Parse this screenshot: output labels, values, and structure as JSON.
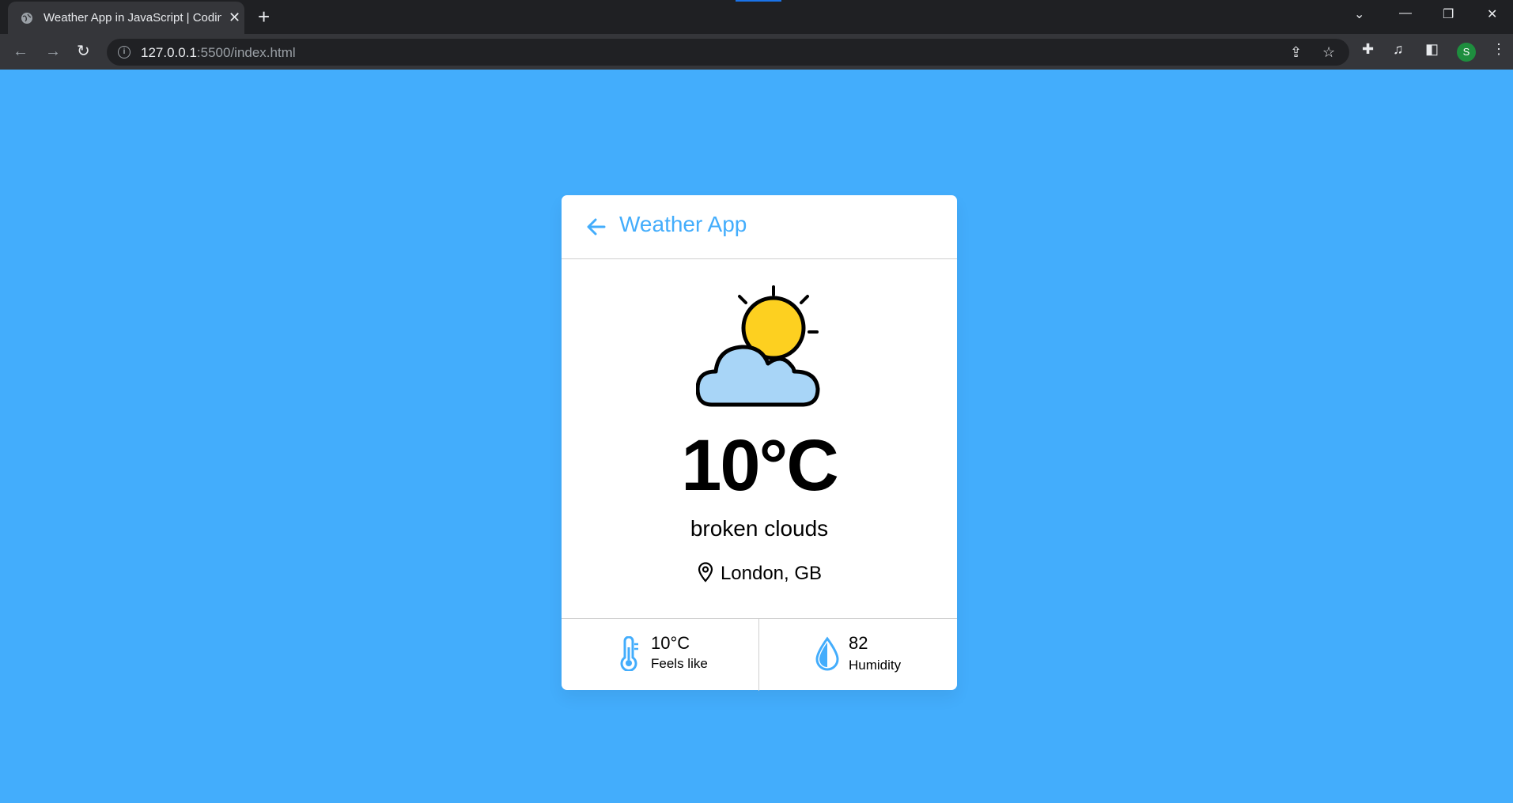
{
  "browser": {
    "tab_title": "Weather App in JavaScript | Coding",
    "url_host": "127.0.0.1",
    "url_rest": ":5500/index.html",
    "profile_initial": "S"
  },
  "app": {
    "title": "Weather App",
    "accent_color": "#43adfc",
    "weather_icon": "partly-cloudy-icon",
    "temperature": "10",
    "temperature_unit": "°C",
    "description": "broken clouds",
    "location": "London, GB",
    "feels_like": {
      "value": "10°C",
      "label": "Feels like"
    },
    "humidity": {
      "value": "82",
      "label": "Humidity"
    }
  }
}
